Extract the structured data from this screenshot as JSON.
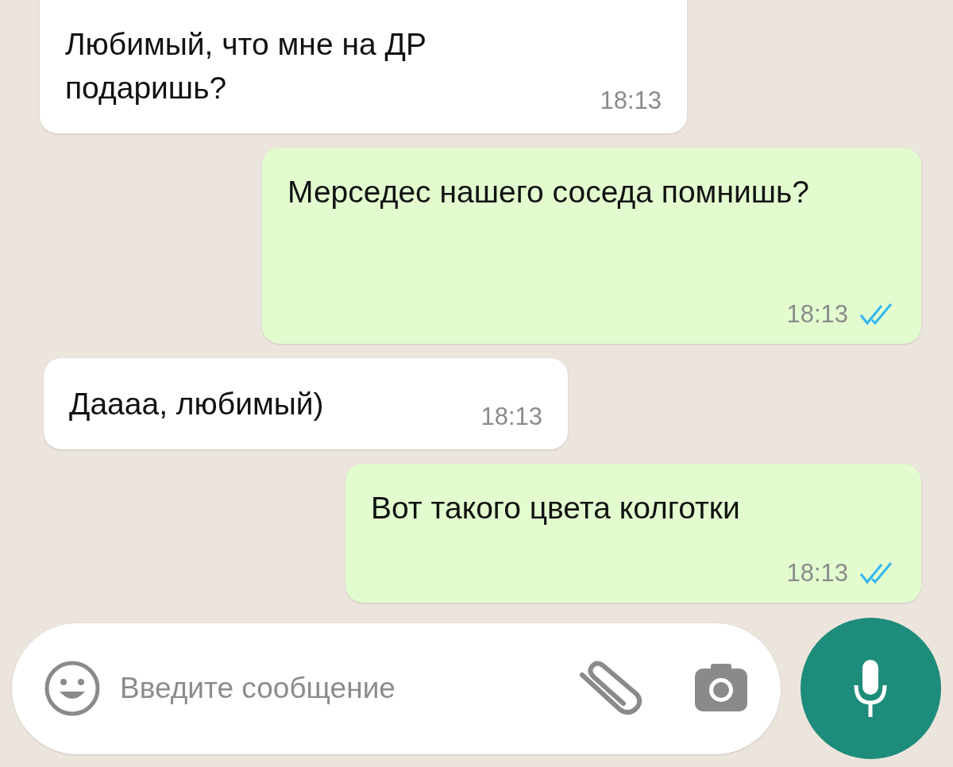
{
  "messages": [
    {
      "kind": "incoming",
      "text": "Любимый, что мне на ДР подаришь?",
      "time": "18:13"
    },
    {
      "kind": "outgoing",
      "text": "Мерседес нашего соседа помнишь?",
      "time": "18:13",
      "read": true
    },
    {
      "kind": "incoming",
      "text": "Даааа, любимый)",
      "time": "18:13"
    },
    {
      "kind": "outgoing",
      "text": "Вот такого цвета колготки",
      "time": "18:13",
      "read": true
    }
  ],
  "composer": {
    "placeholder": "Введите сообщение"
  }
}
